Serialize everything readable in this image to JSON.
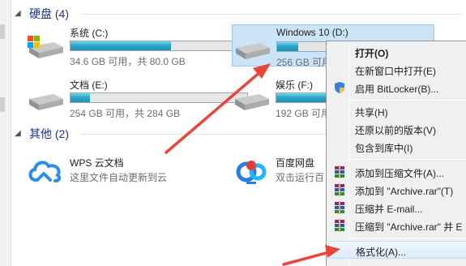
{
  "groups": {
    "disks": {
      "label": "硬盘 (4)"
    },
    "other": {
      "label": "其他 (2)"
    }
  },
  "drives": [
    {
      "name": "系统 (C:)",
      "space": "34.6 GB 可用，共 80.0 GB",
      "used_fraction": 0.57
    },
    {
      "name": "Windows 10 (D:)",
      "space": "256 GB 可用",
      "used_fraction": 0.12
    },
    {
      "name": "文档 (E:)",
      "space": "254 GB 可用，共 284 GB",
      "used_fraction": 0.11
    },
    {
      "name": "娱乐 (F:)",
      "space": "192 GB 可用",
      "used_fraction": 0.33
    }
  ],
  "apps": [
    {
      "name": "WPS 云文档",
      "desc": "这里文件自动更新到云"
    },
    {
      "name": "百度网盘",
      "desc": "双击运行百"
    }
  ],
  "context_menu": {
    "items": [
      {
        "label": "打开(O)",
        "bold": true,
        "icon": ""
      },
      {
        "label": "在新窗口中打开(E)",
        "icon": ""
      },
      {
        "label": "启用 BitLocker(B)...",
        "icon": "shield-icon"
      },
      {
        "label": "共享(H)",
        "icon": ""
      },
      {
        "label": "还原以前的版本(V)",
        "icon": ""
      },
      {
        "label": "包含到库中(I)",
        "icon": ""
      },
      {
        "label": "添加到压缩文件(A)...",
        "icon": "winrar-icon"
      },
      {
        "label": "添加到 \"Archive.rar\"(T)",
        "icon": "winrar-icon"
      },
      {
        "label": "压缩并 E-mail...",
        "icon": "winrar-icon"
      },
      {
        "label": "压缩到 \"Archive.rar\" 并 E",
        "icon": "winrar-icon"
      },
      {
        "label": "格式化(A)...",
        "icon": "",
        "highlighted": true
      }
    ]
  },
  "colors": {
    "accent": "#1e3287",
    "arrow": "#e8453c",
    "selection": "#cce4f7",
    "bar_fill": "#29a7c9"
  }
}
